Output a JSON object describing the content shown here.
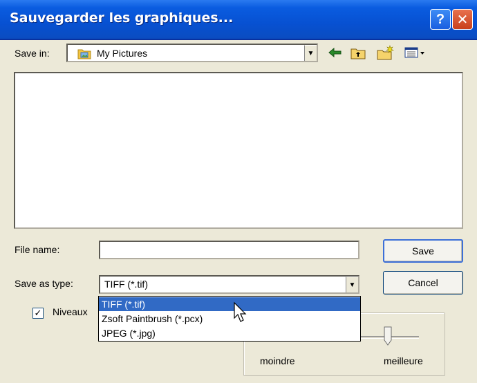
{
  "window": {
    "title": "Sauvegarder les graphiques...",
    "help_symbol": "?",
    "close_symbol": "✕"
  },
  "save_in": {
    "label": "Save in:",
    "value": "My Pictures"
  },
  "toolbar": {
    "icons": [
      "back-icon",
      "up-folder-icon",
      "new-folder-icon",
      "view-menu-icon"
    ]
  },
  "file_name": {
    "label": "File name:",
    "value": ""
  },
  "save_as_type": {
    "label": "Save as type:",
    "value": "TIFF (*.tif)",
    "options": [
      "TIFF (*.tif)",
      "Zsoft Paintbrush (*.pcx)",
      "JPEG (*.jpg)"
    ],
    "highlighted_index": 0
  },
  "buttons": {
    "save": "Save",
    "cancel": "Cancel"
  },
  "levels_checkbox": {
    "label": "Niveaux",
    "checked": true,
    "check_mark": "✓"
  },
  "quality": {
    "min_label": "moindre",
    "max_label": "meilleure",
    "level": 0.78
  },
  "colors": {
    "titlebar": "#0751d2",
    "selection": "#316ac5",
    "dialog_bg": "#ece9d8"
  }
}
